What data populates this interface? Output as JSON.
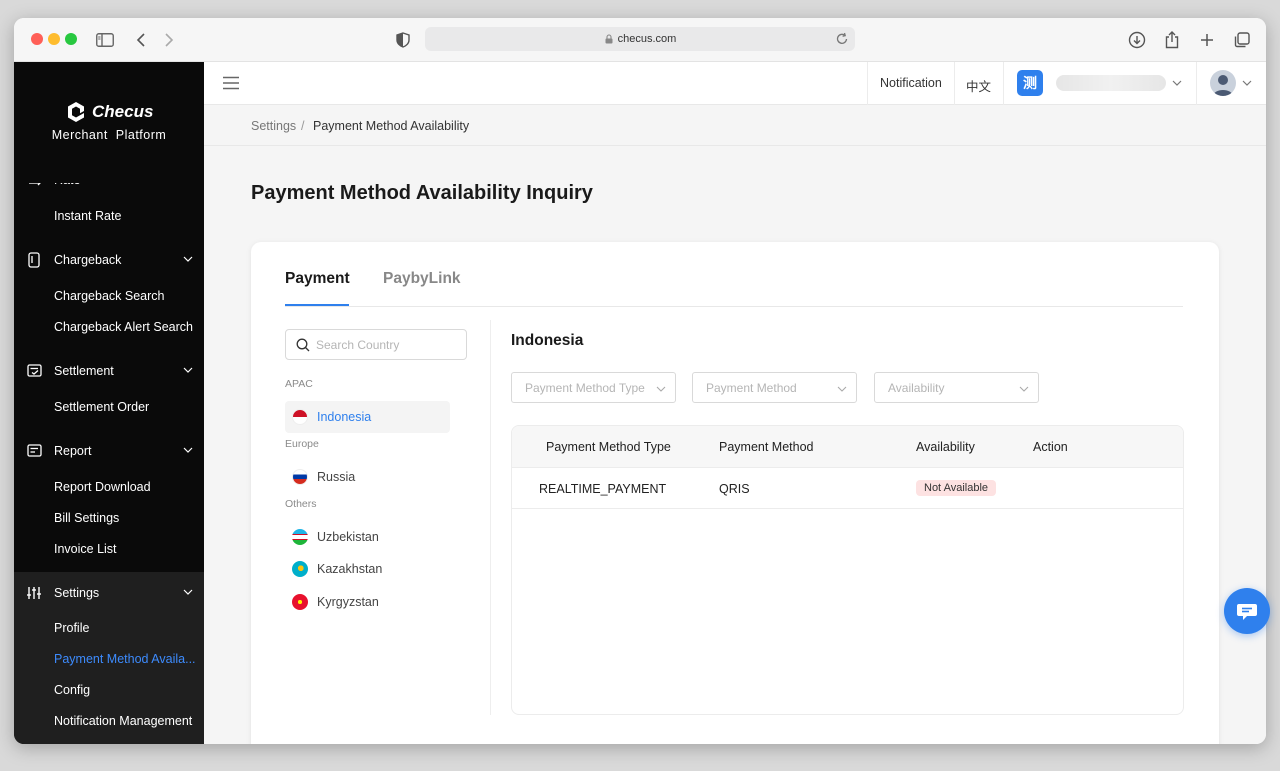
{
  "browser": {
    "url": "checus.com"
  },
  "brand": {
    "name": "Checus",
    "subtitle": "Merchant  Platform"
  },
  "sidebar": {
    "items": [
      {
        "label": "Rate",
        "type": "parent-partial"
      },
      {
        "label": "Instant Rate",
        "type": "sub"
      },
      {
        "label": "Chargeback",
        "type": "parent"
      },
      {
        "label": "Chargeback Search",
        "type": "sub"
      },
      {
        "label": "Chargeback Alert Search",
        "type": "sub"
      },
      {
        "label": "Settlement",
        "type": "parent"
      },
      {
        "label": "Settlement Order",
        "type": "sub"
      },
      {
        "label": "Report",
        "type": "parent"
      },
      {
        "label": "Report Download",
        "type": "sub"
      },
      {
        "label": "Bill Settings",
        "type": "sub"
      },
      {
        "label": "Invoice List",
        "type": "sub"
      },
      {
        "label": "Settings",
        "type": "parent"
      },
      {
        "label": "Profile",
        "type": "sub"
      },
      {
        "label": "Payment Method Availa...",
        "type": "sub",
        "active": true
      },
      {
        "label": "Config",
        "type": "sub"
      },
      {
        "label": "Notification Management",
        "type": "sub"
      }
    ]
  },
  "header": {
    "notification": "Notification",
    "language": "中文",
    "account_badge": "测"
  },
  "breadcrumb": {
    "parent": "Settings",
    "separator": "/",
    "current": "Payment Method Availability"
  },
  "page": {
    "title": "Payment Method Availability Inquiry"
  },
  "tabs": [
    {
      "label": "Payment",
      "active": true
    },
    {
      "label": "PaybyLink",
      "active": false
    }
  ],
  "search": {
    "placeholder": "Search Country"
  },
  "regions": [
    {
      "name": "APAC",
      "countries": [
        "Indonesia"
      ]
    },
    {
      "name": "Europe",
      "countries": [
        "Russia"
      ]
    },
    {
      "name": "Others",
      "countries": [
        "Uzbekistan",
        "Kazakhstan",
        "Kyrgyzstan"
      ]
    }
  ],
  "selected_country": "Indonesia",
  "filters": {
    "type_placeholder": "Payment Method Type",
    "method_placeholder": "Payment Method",
    "availability_placeholder": "Availability"
  },
  "table": {
    "columns": [
      "Payment Method Type",
      "Payment Method",
      "Availability",
      "Action"
    ],
    "rows": [
      {
        "type": "REALTIME_PAYMENT",
        "method": "QRIS",
        "availability": "Not Available",
        "action": ""
      }
    ]
  },
  "colors": {
    "accent": "#2f80ed",
    "sidebar_bg": "#0a0a0a",
    "badge_bg": "#fde2e2"
  }
}
